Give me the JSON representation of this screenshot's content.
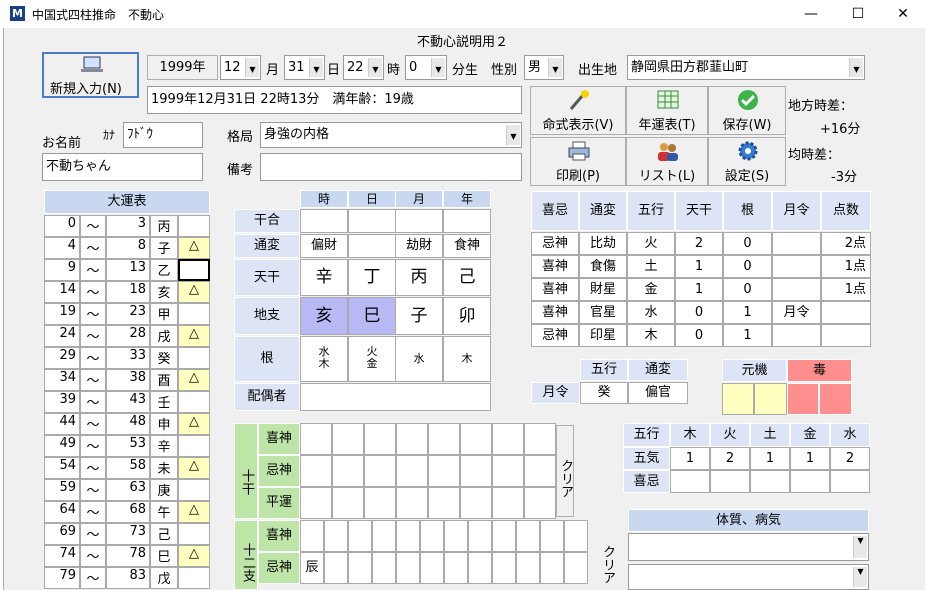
{
  "window": {
    "title": "中国式四柱推命　不動心",
    "app_icon": "M",
    "minimize": "—",
    "maximize": "☐",
    "close": "✕"
  },
  "caption": "不動心説明用２",
  "new_entry_label": "新規入力(N)",
  "birth": {
    "year": "1999年",
    "month": "12",
    "month_unit": "月",
    "day": "31",
    "day_unit": "日",
    "hour": "22",
    "hour_unit": "時",
    "minute": "0",
    "minute_unit": "分生",
    "gender_label": "性別",
    "gender": "男",
    "place_label": "出生地",
    "place": "静岡県田方郡韮山町"
  },
  "summary_text": "1999年12月31日 22時13分　満年齢：19歳",
  "name": {
    "label": "お名前",
    "kana_label": "ｶﾅ",
    "kana": "ﾌﾄﾞｳ",
    "value": "不動ちゃん"
  },
  "kakukyoku": {
    "label": "格局",
    "value": "身強の内格"
  },
  "biko": {
    "label": "備考",
    "value": ""
  },
  "tools": [
    {
      "label": "命式表示(V)",
      "icon": "wand-icon"
    },
    {
      "label": "年運表(T)",
      "icon": "grid-icon"
    },
    {
      "label": "保存(W)",
      "icon": "check-icon"
    },
    {
      "label": "印刷(P)",
      "icon": "printer-icon"
    },
    {
      "label": "リスト(L)",
      "icon": "users-icon"
    },
    {
      "label": "設定(S)",
      "icon": "gear-icon"
    }
  ],
  "time_diff": {
    "local_label": "地方時差：",
    "local_value": "+16分",
    "eq_label": "均時差：",
    "eq_value": "-3分"
  },
  "taiun": {
    "title": "大運表",
    "tilde": "〜",
    "rows": [
      {
        "from": "0",
        "to": "3",
        "kan": "丙",
        "mark": ""
      },
      {
        "from": "4",
        "to": "8",
        "kan": "子",
        "mark": "△"
      },
      {
        "from": "9",
        "to": "13",
        "kan": "乙",
        "mark": ""
      },
      {
        "from": "14",
        "to": "18",
        "kan": "亥",
        "mark": "△"
      },
      {
        "from": "19",
        "to": "23",
        "kan": "甲",
        "mark": ""
      },
      {
        "from": "24",
        "to": "28",
        "kan": "戌",
        "mark": "△"
      },
      {
        "from": "29",
        "to": "33",
        "kan": "癸",
        "mark": ""
      },
      {
        "from": "34",
        "to": "38",
        "kan": "酉",
        "mark": "△"
      },
      {
        "from": "39",
        "to": "43",
        "kan": "壬",
        "mark": ""
      },
      {
        "from": "44",
        "to": "48",
        "kan": "申",
        "mark": "△"
      },
      {
        "from": "49",
        "to": "53",
        "kan": "辛",
        "mark": ""
      },
      {
        "from": "54",
        "to": "58",
        "kan": "未",
        "mark": "△"
      },
      {
        "from": "59",
        "to": "63",
        "kan": "庚",
        "mark": ""
      },
      {
        "from": "64",
        "to": "68",
        "kan": "午",
        "mark": "△"
      },
      {
        "from": "69",
        "to": "73",
        "kan": "己",
        "mark": ""
      },
      {
        "from": "74",
        "to": "78",
        "kan": "巳",
        "mark": "△"
      },
      {
        "from": "79",
        "to": "83",
        "kan": "戊",
        "mark": ""
      }
    ]
  },
  "meishiki": {
    "cols": [
      "時",
      "日",
      "月",
      "年"
    ],
    "row_labels": {
      "kango": "干合",
      "tsuhen": "通変",
      "tenkan": "天干",
      "chishi": "地支",
      "ne": "根",
      "haigusha": "配偶者"
    },
    "kango": [
      "",
      "",
      "",
      ""
    ],
    "tsuhen": [
      "偏財",
      "",
      "劫財",
      "食神"
    ],
    "tenkan": [
      "辛",
      "丁",
      "丙",
      "己"
    ],
    "chishi": [
      "亥",
      "巳",
      "子",
      "卯"
    ],
    "ne": [
      [
        "水",
        "木"
      ],
      [
        "火",
        "金"
      ],
      [
        "水"
      ],
      [
        "木"
      ]
    ],
    "haigusha": ""
  },
  "kankan": {
    "title": "十干",
    "rows": [
      "喜神",
      "忌神",
      "平運"
    ],
    "clear": "クリア"
  },
  "junishi": {
    "title": "十二支",
    "rows": [
      "喜神",
      "忌神"
    ],
    "first_value": "辰",
    "clear": "クリア"
  },
  "score": {
    "headers": [
      "喜忌",
      "通変",
      "五行",
      "天干",
      "根",
      "月令",
      "点数"
    ],
    "rows": [
      [
        "忌神",
        "比劫",
        "火",
        "2",
        "0",
        "",
        "2点"
      ],
      [
        "喜神",
        "食傷",
        "土",
        "1",
        "0",
        "",
        "1点"
      ],
      [
        "喜神",
        "財星",
        "金",
        "1",
        "0",
        "",
        "1点"
      ],
      [
        "喜神",
        "官星",
        "水",
        "0",
        "1",
        "月令",
        ""
      ],
      [
        "忌神",
        "印星",
        "木",
        "0",
        "1",
        "",
        ""
      ]
    ]
  },
  "getsurei": {
    "label": "月令",
    "gogyo_label": "五行",
    "tsuhen_label": "通変",
    "gogyo": "癸",
    "tsuhen": "偏官"
  },
  "genki": {
    "label": "元機",
    "doku": "毒"
  },
  "gogyo_table": {
    "head": "五行",
    "elements": [
      "木",
      "火",
      "土",
      "金",
      "水"
    ],
    "gouki_label": "五気",
    "gouki": [
      "1",
      "2",
      "1",
      "1",
      "2"
    ],
    "kiki_label": "喜忌"
  },
  "taishitsu": {
    "title": "体質、病気"
  }
}
